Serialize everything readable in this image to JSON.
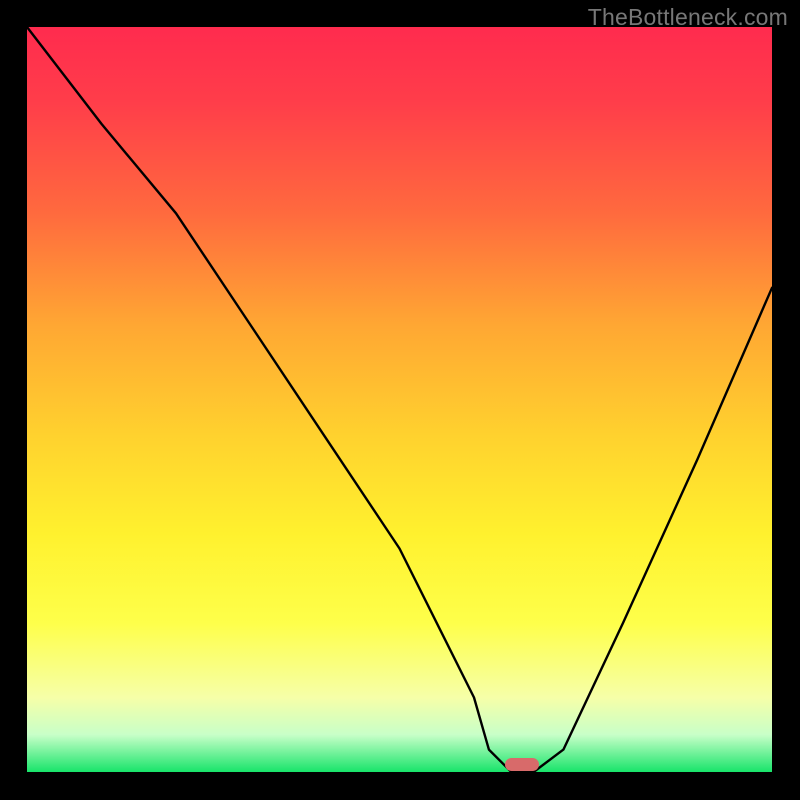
{
  "watermark": "TheBottleneck.com",
  "chart_data": {
    "type": "line",
    "title": "",
    "xlabel": "",
    "ylabel": "",
    "xlim": [
      0,
      100
    ],
    "ylim": [
      0,
      100
    ],
    "x": [
      0,
      10,
      20,
      30,
      40,
      50,
      60,
      62,
      65,
      68,
      72,
      80,
      90,
      100
    ],
    "values": [
      100,
      87,
      75,
      60,
      45,
      30,
      10,
      3,
      0,
      0,
      3,
      20,
      42,
      65
    ],
    "marker": {
      "x": 66.5,
      "y": 0,
      "color": "#d86a6a"
    },
    "gradient_stops": [
      {
        "pos": 0,
        "color": "#ff2b4e"
      },
      {
        "pos": 25,
        "color": "#ff6a3e"
      },
      {
        "pos": 55,
        "color": "#ffd22e"
      },
      {
        "pos": 80,
        "color": "#feff4a"
      },
      {
        "pos": 95,
        "color": "#c8ffc8"
      },
      {
        "pos": 100,
        "color": "#18e46a"
      }
    ]
  }
}
